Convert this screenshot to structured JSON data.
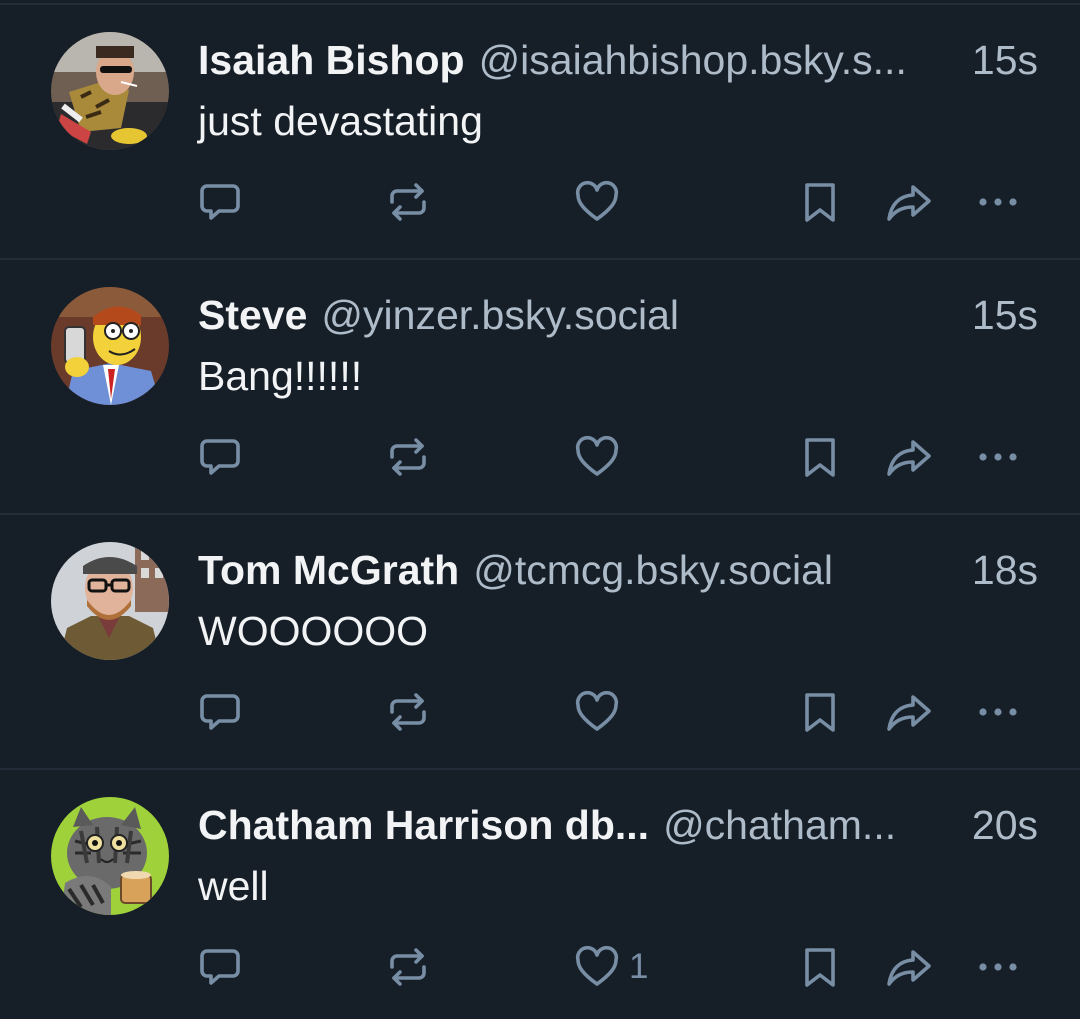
{
  "colors": {
    "background": "#161e27",
    "divider": "#232d39",
    "primary_text": "#f1f3f5",
    "secondary_text": "#aebbc9",
    "icon": "#788ea5"
  },
  "posts": [
    {
      "display_name": "Isaiah Bishop",
      "handle": "@isaiahbishop.bsky.s...",
      "time": "15s",
      "text": "just devastating",
      "like_count": "",
      "avatar": "avatar-sunglasses-man"
    },
    {
      "display_name": "Steve",
      "handle": "@yinzer.bsky.social",
      "time": "15s",
      "text": "Bang!!!!!!",
      "like_count": "",
      "avatar": "avatar-cartoon-lawyer"
    },
    {
      "display_name": "Tom McGrath",
      "handle": "@tcmcg.bsky.social",
      "time": "18s",
      "text": "WOOOOOO",
      "like_count": "",
      "avatar": "avatar-bearded-man-cap"
    },
    {
      "display_name": "Chatham Harrison db...",
      "handle": "@chatham...",
      "time": "20s",
      "text": "well",
      "like_count": "1",
      "avatar": "avatar-illustrated-cat"
    }
  ],
  "icons": {
    "reply": "reply-icon",
    "repost": "repost-icon",
    "like": "heart-icon",
    "bookmark": "bookmark-icon",
    "share": "share-icon",
    "more": "more-icon"
  }
}
